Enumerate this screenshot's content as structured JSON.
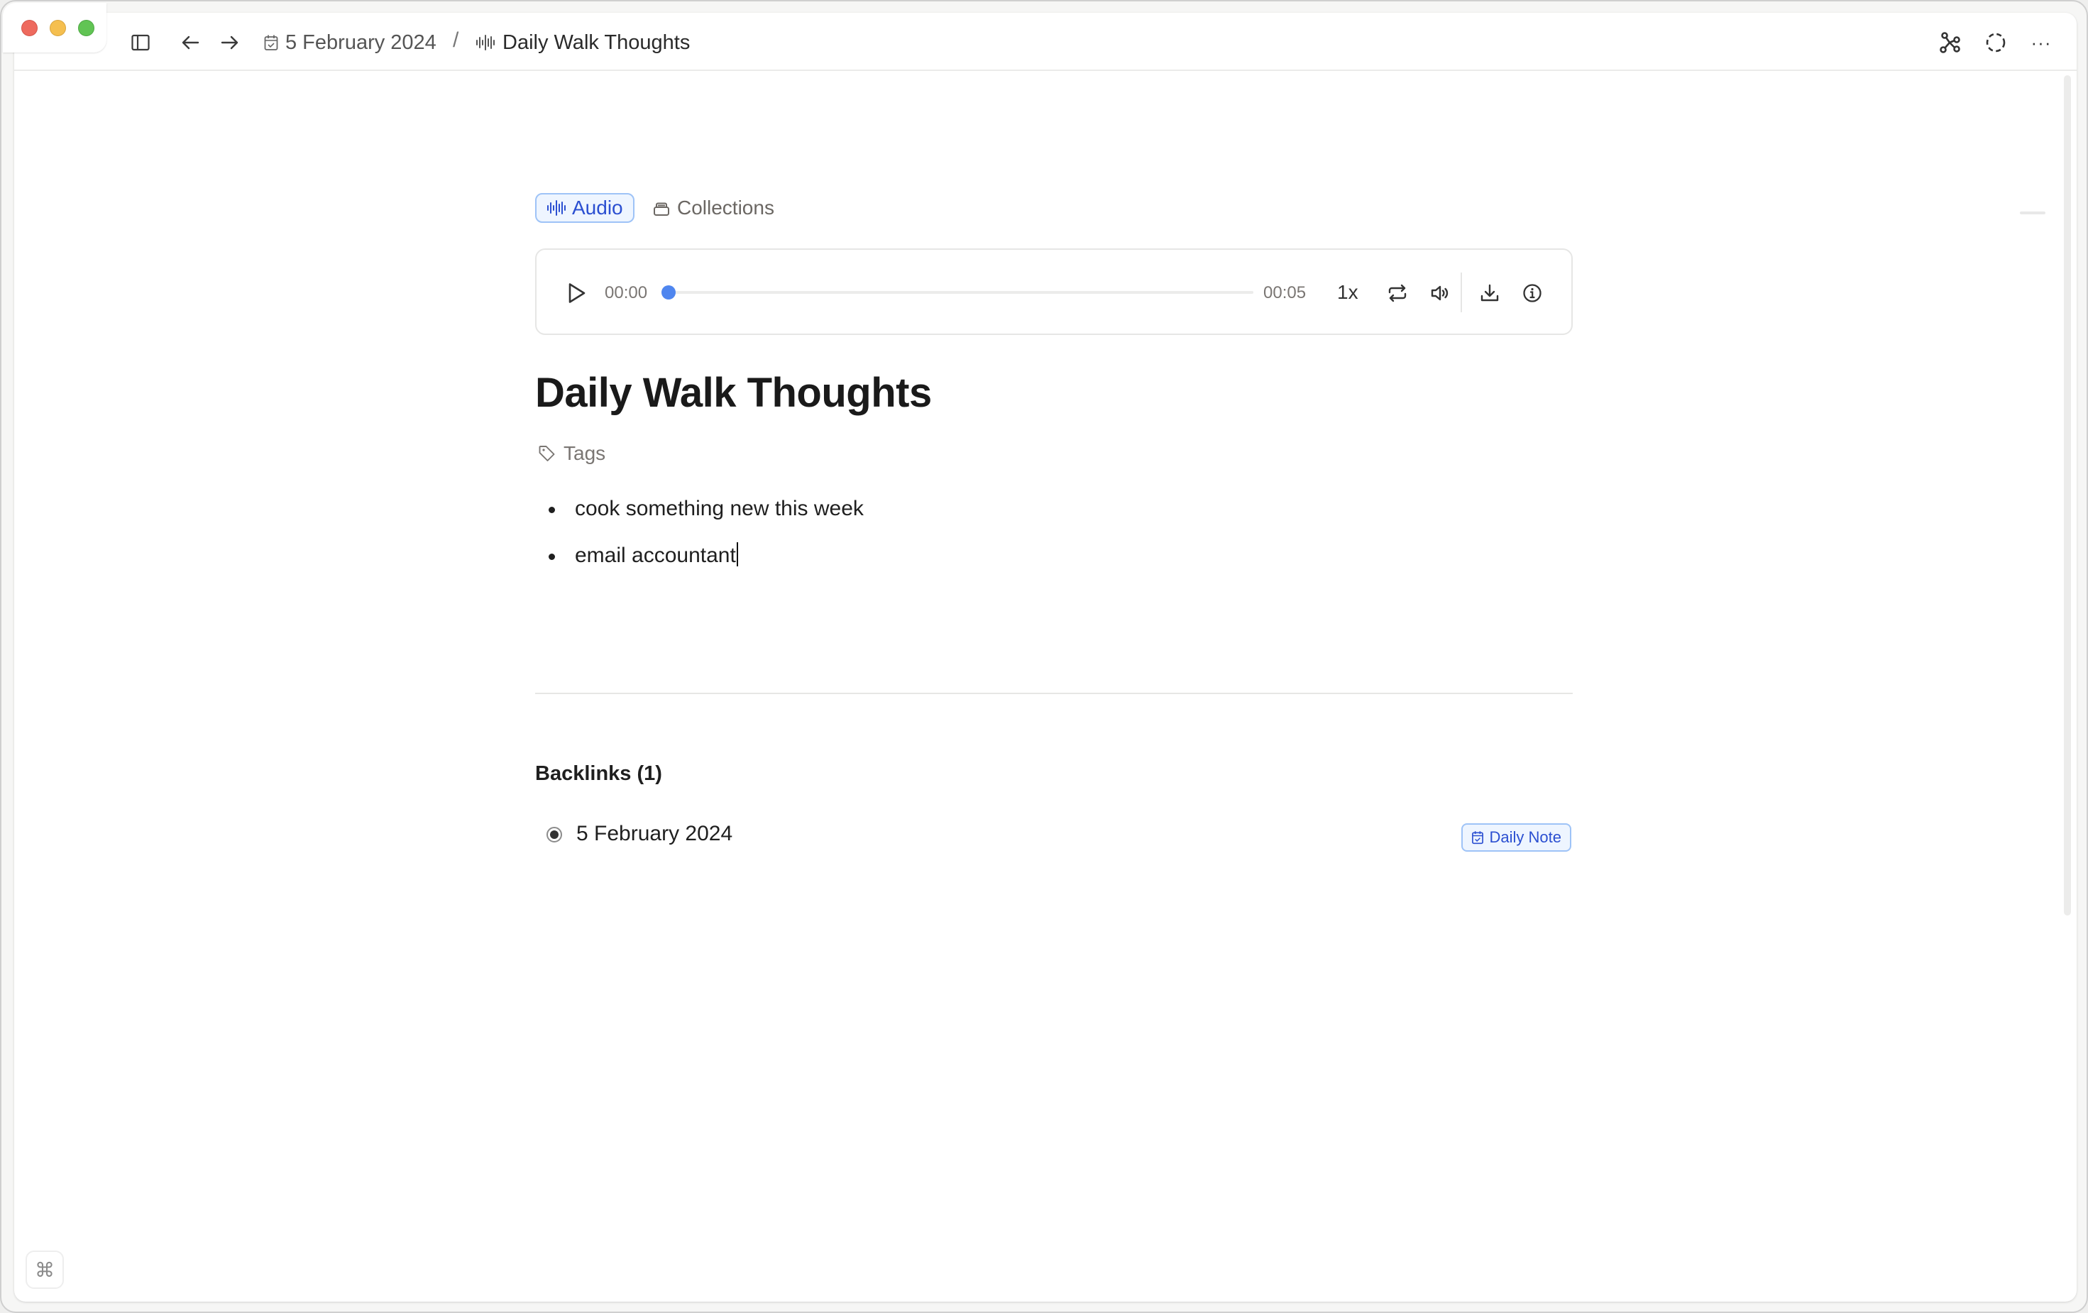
{
  "window": {
    "traffic_lights": [
      "close",
      "minimize",
      "zoom"
    ]
  },
  "topbar": {
    "sidebar_toggle_icon": "sidebar-icon",
    "back_icon": "arrow-left-icon",
    "forward_icon": "arrow-right-icon",
    "breadcrumb": [
      {
        "label": "5 February 2024",
        "icon": "calendar-check-icon"
      },
      {
        "label": "Daily Walk Thoughts",
        "icon": "audio-waveform-icon"
      }
    ],
    "separator": "/",
    "right_icons": [
      "graph-icon",
      "sync-dashed-circle-icon",
      "more-icon"
    ],
    "more_label": "···"
  },
  "note": {
    "collections": [
      {
        "label": "Audio",
        "icon": "audio-waveform-icon",
        "active": true
      },
      {
        "label": "Collections",
        "icon": "collections-stack-icon",
        "active": false
      }
    ],
    "player": {
      "current_time": "00:00",
      "duration": "00:05",
      "progress": 0,
      "playback_rate": "1x",
      "accent_color": "#4f86ef"
    },
    "title": "Daily Walk Thoughts",
    "tags_label": "Tags",
    "bullets": [
      "cook something new this week",
      "email accountant"
    ],
    "backlinks": {
      "heading": "Backlinks (1)",
      "items": [
        {
          "title": "5 February 2024",
          "badge": "Daily Note"
        }
      ]
    }
  },
  "footer": {
    "command_symbol": "⌘"
  },
  "colors": {
    "accent_blue": "#2b4fd1",
    "chip_bg": "#eef5ff",
    "chip_border": "#9ec3f7"
  }
}
